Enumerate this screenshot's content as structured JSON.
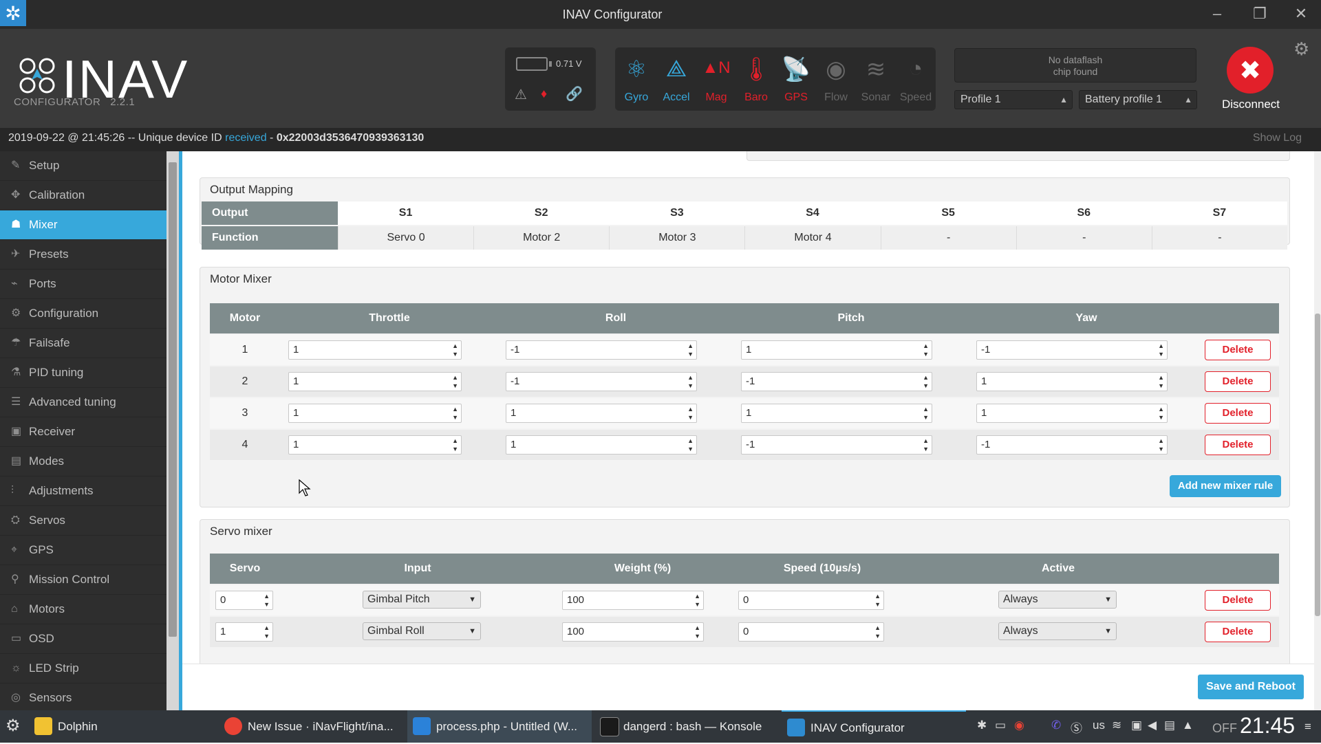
{
  "window": {
    "title": "INAV Configurator"
  },
  "header": {
    "logo": "INAV",
    "sub_label": "CONFIGURATOR",
    "version": "2.2.1",
    "battery_voltage": "0.71 V",
    "sensors": [
      {
        "name": "Gyro",
        "state": "active"
      },
      {
        "name": "Accel",
        "state": "active"
      },
      {
        "name": "Mag",
        "state": "error"
      },
      {
        "name": "Baro",
        "state": "error"
      },
      {
        "name": "GPS",
        "state": "error"
      },
      {
        "name": "Flow",
        "state": "off"
      },
      {
        "name": "Sonar",
        "state": "off"
      },
      {
        "name": "Speed",
        "state": "off"
      }
    ],
    "dataflash_line1": "No dataflash",
    "dataflash_line2": "chip found",
    "profile": "Profile 1",
    "battery_profile": "Battery profile 1",
    "disconnect_label": "Disconnect"
  },
  "status": {
    "prefix": "2019-09-22 @ 21:45:26 -- Unique device ID",
    "link": "received",
    "dash": "-",
    "device_id": "0x22003d3536470939363130",
    "show_log": "Show Log"
  },
  "sidebar": {
    "items": [
      {
        "label": "Setup",
        "icon": "wrench-icon"
      },
      {
        "label": "Calibration",
        "icon": "calibration-icon"
      },
      {
        "label": "Mixer",
        "icon": "mixer-icon"
      },
      {
        "label": "Presets",
        "icon": "presets-icon"
      },
      {
        "label": "Ports",
        "icon": "ports-icon"
      },
      {
        "label": "Configuration",
        "icon": "gear-icon"
      },
      {
        "label": "Failsafe",
        "icon": "parachute-icon"
      },
      {
        "label": "PID tuning",
        "icon": "pid-icon"
      },
      {
        "label": "Advanced tuning",
        "icon": "advanced-icon"
      },
      {
        "label": "Receiver",
        "icon": "receiver-icon"
      },
      {
        "label": "Modes",
        "icon": "modes-icon"
      },
      {
        "label": "Adjustments",
        "icon": "sliders-icon"
      },
      {
        "label": "Servos",
        "icon": "servo-icon"
      },
      {
        "label": "GPS",
        "icon": "gps-icon"
      },
      {
        "label": "Mission Control",
        "icon": "map-pin-icon"
      },
      {
        "label": "Motors",
        "icon": "motor-icon"
      },
      {
        "label": "OSD",
        "icon": "osd-icon"
      },
      {
        "label": "LED Strip",
        "icon": "led-icon"
      },
      {
        "label": "Sensors",
        "icon": "sensors-icon"
      }
    ],
    "active": "Mixer"
  },
  "output_mapping": {
    "title": "Output Mapping",
    "row1_label": "Output",
    "row2_label": "Function",
    "outputs": [
      "S1",
      "S2",
      "S3",
      "S4",
      "S5",
      "S6",
      "S7"
    ],
    "functions": [
      "Servo 0",
      "Motor 2",
      "Motor 3",
      "Motor 4",
      "-",
      "-",
      "-"
    ]
  },
  "motor_mixer": {
    "title": "Motor Mixer",
    "headers": [
      "Motor",
      "Throttle",
      "Roll",
      "Pitch",
      "Yaw"
    ],
    "rows": [
      {
        "motor": "1",
        "throttle": "1",
        "roll": "-1",
        "pitch": "1",
        "yaw": "-1"
      },
      {
        "motor": "2",
        "throttle": "1",
        "roll": "-1",
        "pitch": "-1",
        "yaw": "1"
      },
      {
        "motor": "3",
        "throttle": "1",
        "roll": "1",
        "pitch": "1",
        "yaw": "1"
      },
      {
        "motor": "4",
        "throttle": "1",
        "roll": "1",
        "pitch": "-1",
        "yaw": "-1"
      }
    ],
    "delete_label": "Delete",
    "add_label": "Add new mixer rule"
  },
  "servo_mixer": {
    "title": "Servo mixer",
    "headers": [
      "Servo",
      "Input",
      "Weight (%)",
      "Speed (10µs/s)",
      "Active"
    ],
    "rows": [
      {
        "servo": "0",
        "input": "Gimbal Pitch",
        "weight": "100",
        "speed": "0",
        "active": "Always"
      },
      {
        "servo": "1",
        "input": "Gimbal Roll",
        "weight": "100",
        "speed": "0",
        "active": "Always"
      }
    ],
    "delete_label": "Delete"
  },
  "save_reboot": "Save and Reboot",
  "taskbar": {
    "tasks": [
      {
        "label": "Dolphin"
      },
      {
        "label": "New Issue · iNavFlight/ina..."
      },
      {
        "label": "process.php - Untitled (W..."
      },
      {
        "label": "dangerd : bash — Konsole"
      },
      {
        "label": "INAV Configurator"
      }
    ],
    "keyboard_layout": "us",
    "off_label": "OFF",
    "clock": "21:45"
  },
  "colors": {
    "accent": "#37a8db",
    "danger": "#e2202a",
    "header_bg": "#3a3a3a"
  }
}
